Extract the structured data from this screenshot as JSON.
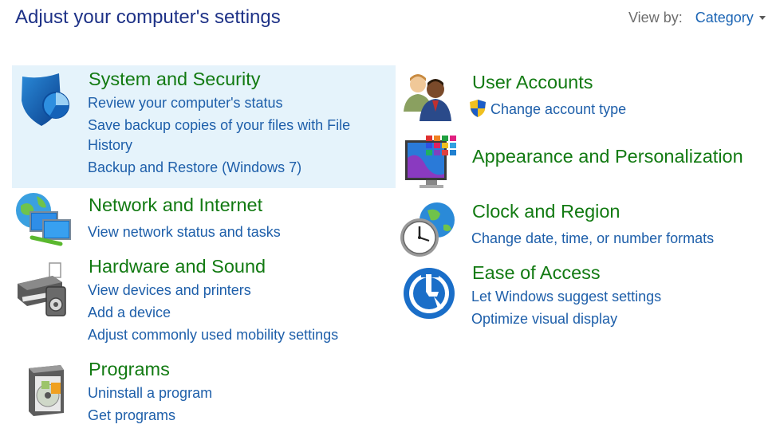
{
  "header": {
    "title": "Adjust your computer's settings",
    "view_by_label": "View by:",
    "view_by_value": "Category"
  },
  "categories": {
    "system_security": {
      "title": "System and Security",
      "links": [
        "Review your computer's status",
        "Save backup copies of your files with File",
        "History",
        "Backup and Restore (Windows 7)"
      ]
    },
    "network": {
      "title": "Network and Internet",
      "links": [
        "View network status and tasks"
      ]
    },
    "hardware": {
      "title": "Hardware and Sound",
      "links": [
        "View devices and printers",
        "Add a device",
        "Adjust commonly used mobility settings"
      ]
    },
    "programs": {
      "title": "Programs",
      "links": [
        "Uninstall a program",
        "Get programs"
      ]
    },
    "user_accounts": {
      "title": "User Accounts",
      "links": [
        "Change account type"
      ]
    },
    "appearance": {
      "title": "Appearance and Personalization",
      "links": []
    },
    "clock_region": {
      "title": "Clock and Region",
      "links": [
        "Change date, time, or number formats"
      ]
    },
    "ease_access": {
      "title": "Ease of Access",
      "links": [
        "Let Windows suggest settings",
        "Optimize visual display"
      ]
    }
  },
  "icons": {
    "system_security": "shield-icon",
    "network": "network-globe-icon",
    "hardware": "printer-speaker-icon",
    "programs": "programs-disc-icon",
    "user_accounts": "users-icon",
    "appearance": "monitor-palette-icon",
    "clock_region": "clock-globe-icon",
    "ease_access": "ease-of-access-icon",
    "uac": "uac-shield-icon"
  },
  "colors": {
    "title_blue": "#1e3287",
    "category_green": "#127a12",
    "link_blue": "#1e5faa",
    "highlight": "#e5f3fb"
  }
}
